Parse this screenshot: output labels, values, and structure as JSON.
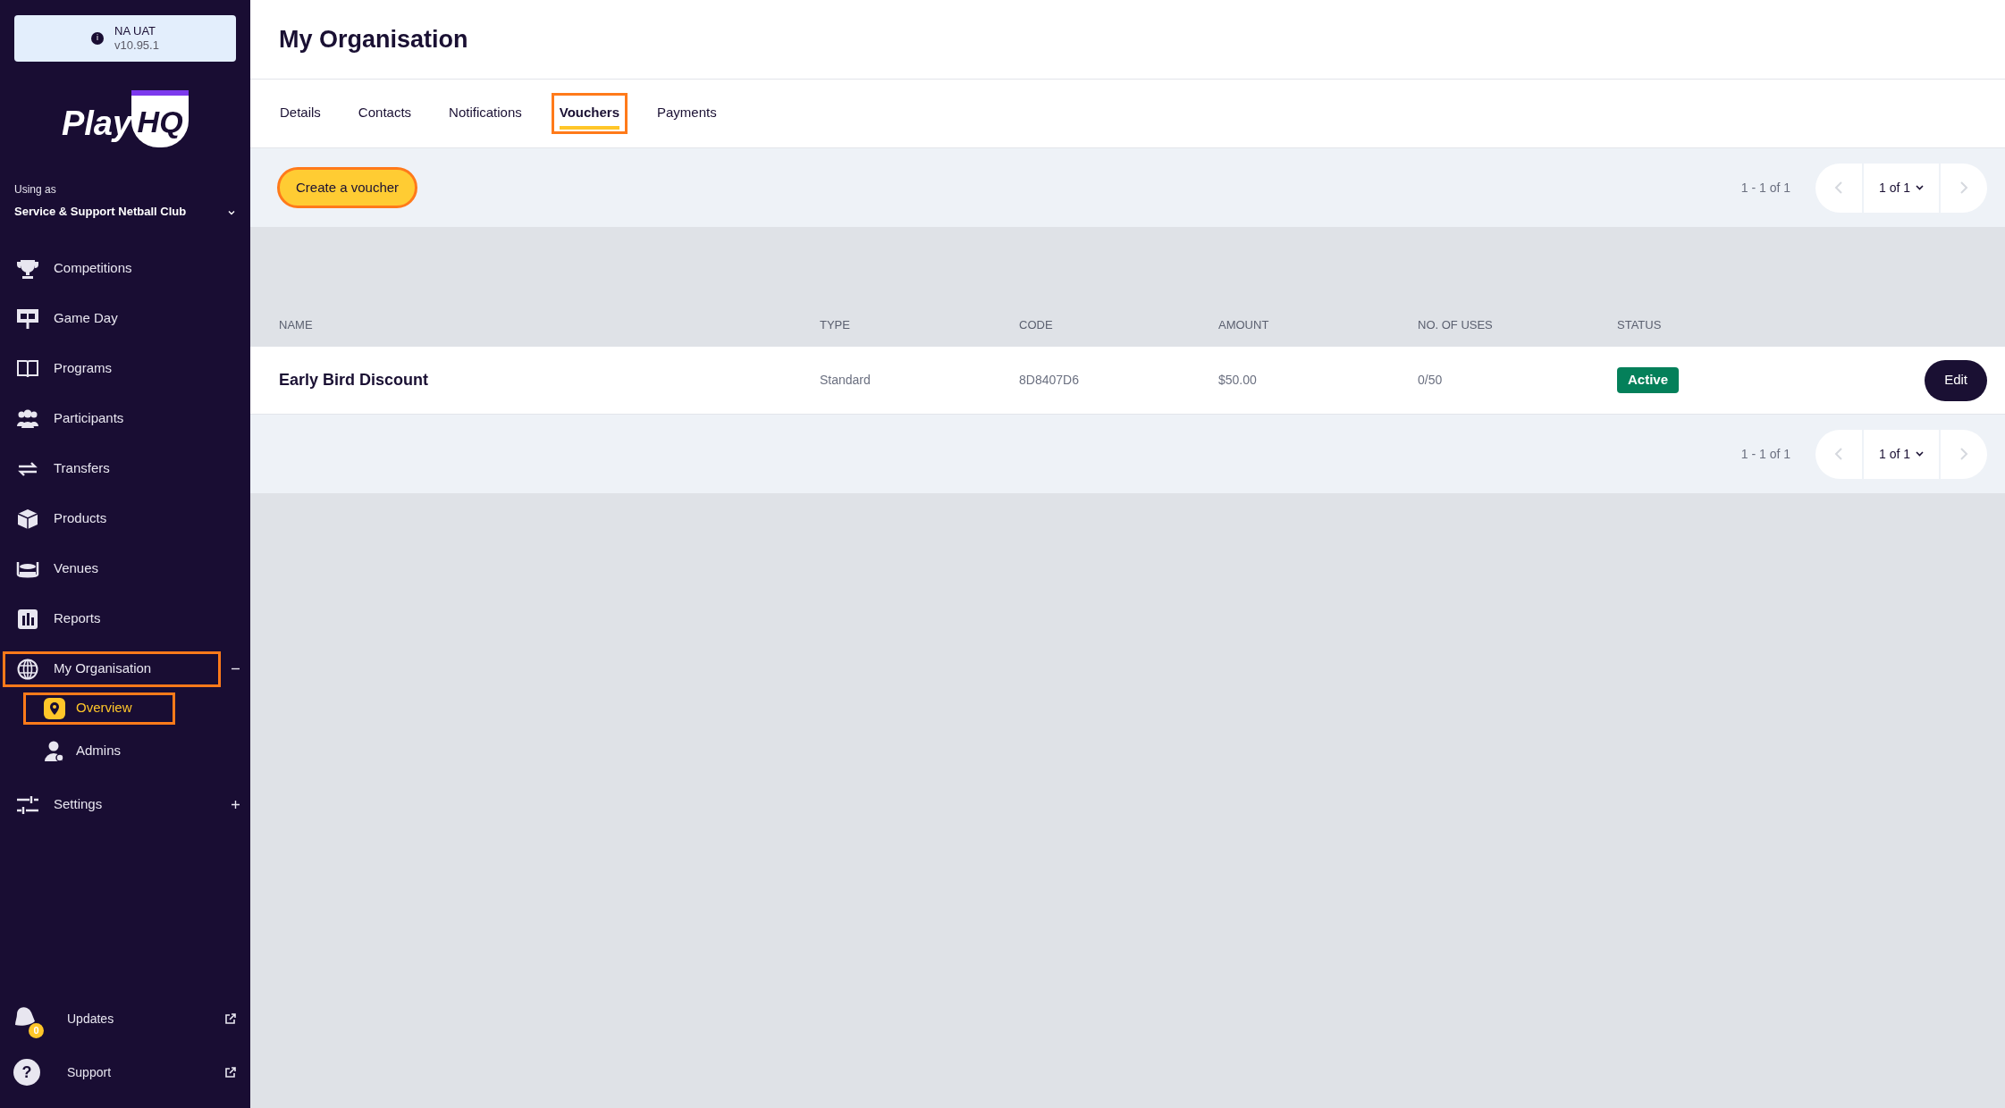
{
  "environment": {
    "name": "NA UAT",
    "version": "v10.95.1",
    "info_icon": "i"
  },
  "logo": {
    "play": "Play",
    "hq": "HQ"
  },
  "org_switcher": {
    "caption": "Using as",
    "name": "Service & Support Netball Club"
  },
  "sidebar": {
    "items": [
      {
        "label": "Competitions",
        "highlighted": false
      },
      {
        "label": "Game Day",
        "highlighted": false
      },
      {
        "label": "Programs",
        "highlighted": false
      },
      {
        "label": "Participants",
        "highlighted": false
      },
      {
        "label": "Transfers",
        "highlighted": false
      },
      {
        "label": "Products",
        "highlighted": false
      },
      {
        "label": "Venues",
        "highlighted": false
      },
      {
        "label": "Reports",
        "highlighted": false
      },
      {
        "label": "My Organisation",
        "highlighted": true,
        "expanded": true,
        "children": [
          {
            "label": "Overview",
            "selected": true,
            "highlighted": true
          },
          {
            "label": "Admins",
            "selected": false,
            "highlighted": false
          }
        ]
      },
      {
        "label": "Settings",
        "highlighted": false,
        "expanded": false
      }
    ],
    "footer": [
      {
        "label": "Updates",
        "badge": "0"
      },
      {
        "label": "Support",
        "icon_text": "?"
      }
    ]
  },
  "page": {
    "title": "My Organisation"
  },
  "tabs": [
    {
      "label": "Details",
      "selected": false,
      "highlighted": false
    },
    {
      "label": "Contacts",
      "selected": false,
      "highlighted": false
    },
    {
      "label": "Notifications",
      "selected": false,
      "highlighted": false
    },
    {
      "label": "Vouchers",
      "selected": true,
      "highlighted": true
    },
    {
      "label": "Payments",
      "selected": false,
      "highlighted": false
    }
  ],
  "toolbar": {
    "create_button": "Create a voucher",
    "create_highlighted": true,
    "range": "1 - 1 of 1",
    "page": "1 of 1",
    "prev_disabled": true,
    "next_disabled": true
  },
  "table": {
    "columns": [
      "NAME",
      "TYPE",
      "CODE",
      "AMOUNT",
      "NO. OF USES",
      "STATUS"
    ],
    "rows": [
      {
        "name": "Early Bird Discount",
        "type": "Standard",
        "code": "8D8407D6",
        "amount": "$50.00",
        "uses": "0/50",
        "status": "Active",
        "action": "Edit"
      }
    ]
  },
  "bottom_pagination": {
    "range": "1 - 1 of 1",
    "page": "1 of 1",
    "prev_disabled": true,
    "next_disabled": true
  }
}
